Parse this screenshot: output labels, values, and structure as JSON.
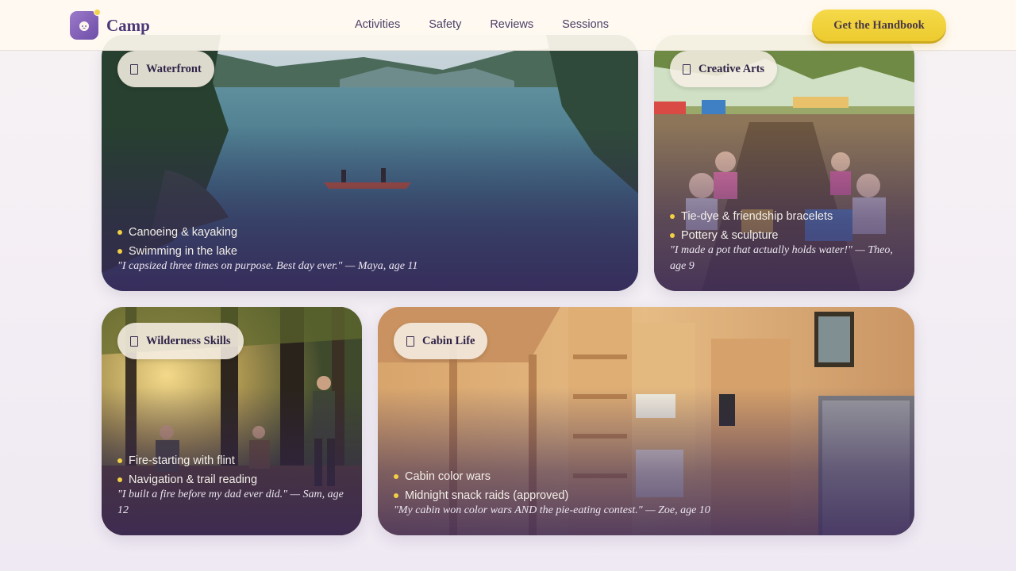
{
  "brand": {
    "name": "Camp",
    "logo_icon": "camper-mascot-icon"
  },
  "nav": {
    "items": [
      "Activities",
      "Safety",
      "Reviews",
      "Sessions"
    ]
  },
  "cta": {
    "label": "Get the Handbook"
  },
  "colors": {
    "accent_yellow": "#f2d03f",
    "brand_purple": "#4a3878",
    "overlay_purple": "#382658"
  },
  "cards": [
    {
      "title": "Waterfront",
      "icon": "tag-icon",
      "image": "lake-canoe-photo",
      "bullets": [
        "Canoeing & kayaking",
        "Swimming in the lake"
      ],
      "quote": "\"I capsized three times on purpose. Best day ever.\" — Maya, age 11"
    },
    {
      "title": "Creative Arts",
      "icon": "tag-icon",
      "image": "kids-crafts-table-photo",
      "bullets": [
        "Tie-dye & friendship bracelets",
        "Pottery & sculpture"
      ],
      "quote": "\"I made a pot that actually holds water!\" — Theo, age 9"
    },
    {
      "title": "Wilderness Skills",
      "icon": "tag-icon",
      "image": "forest-campfire-photo",
      "bullets": [
        "Fire-starting with flint",
        "Navigation & trail reading"
      ],
      "quote": "\"I built a fire before my dad ever did.\" — Sam, age 12"
    },
    {
      "title": "Cabin Life",
      "icon": "tag-icon",
      "image": "wooden-cabin-interior-photo",
      "bullets": [
        "Cabin color wars",
        "Midnight snack raids (approved)"
      ],
      "quote": "\"My cabin won color wars AND the pie-eating contest.\" — Zoe, age 10"
    }
  ]
}
